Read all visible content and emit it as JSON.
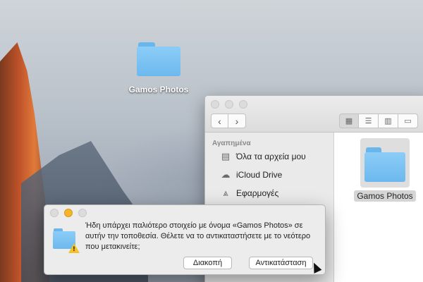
{
  "desktop": {
    "folder_label": "Gamos Photos"
  },
  "finder": {
    "sidebar": {
      "section_title": "Αγαπημένα",
      "items": [
        {
          "label": "Όλα τα αρχεία μου",
          "icon": "all-files-icon"
        },
        {
          "label": "iCloud Drive",
          "icon": "cloud-icon"
        },
        {
          "label": "Εφαρμογές",
          "icon": "applications-icon"
        }
      ]
    },
    "content": {
      "items": [
        {
          "label": "Gamos Photos",
          "icon": "folder-icon"
        }
      ]
    }
  },
  "dialog": {
    "message": "Ήδη υπάρχει παλιότερο στοιχείο με όνομα «Gamos Photos» σε αυτήν την τοποθεσία. Θέλετε να το αντικαταστήσετε με το νεότερο που μετακινείτε;",
    "cancel_label": "Διακοπή",
    "replace_label": "Αντικατάσταση"
  },
  "colors": {
    "folder_blue": "#6cb8ee",
    "warning_yellow": "#f3c12b",
    "minimize_yellow": "#f5b52a"
  }
}
